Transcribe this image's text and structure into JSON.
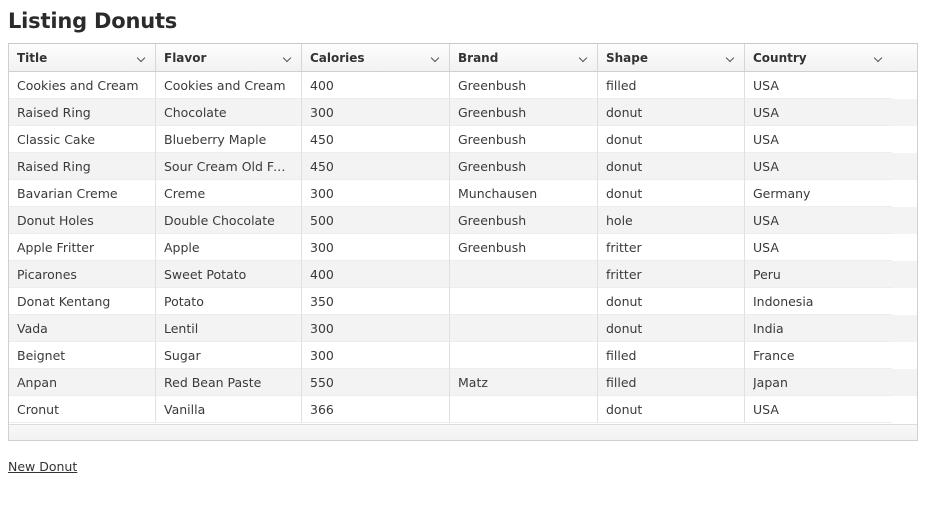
{
  "page": {
    "title": "Listing Donuts"
  },
  "grid": {
    "columns": [
      {
        "label": "Title",
        "icon": "chevron-down-icon"
      },
      {
        "label": "Flavor",
        "icon": "chevron-down-icon"
      },
      {
        "label": "Calories",
        "icon": "chevron-down-icon"
      },
      {
        "label": "Brand",
        "icon": "chevron-down-icon"
      },
      {
        "label": "Shape",
        "icon": "chevron-down-icon"
      },
      {
        "label": "Country",
        "icon": "chevron-down-icon"
      }
    ],
    "rows": [
      {
        "title": "Cookies and Cream",
        "flavor": "Cookies and Cream",
        "calories": "400",
        "brand": "Greenbush",
        "shape": "filled",
        "country": "USA"
      },
      {
        "title": "Raised Ring",
        "flavor": "Chocolate",
        "calories": "300",
        "brand": "Greenbush",
        "shape": "donut",
        "country": "USA"
      },
      {
        "title": "Classic Cake",
        "flavor": "Blueberry Maple",
        "calories": "450",
        "brand": "Greenbush",
        "shape": "donut",
        "country": "USA"
      },
      {
        "title": "Raised Ring",
        "flavor": "Sour Cream Old Fash…",
        "calories": "450",
        "brand": "Greenbush",
        "shape": "donut",
        "country": "USA"
      },
      {
        "title": "Bavarian Creme",
        "flavor": "Creme",
        "calories": "300",
        "brand": "Munchausen",
        "shape": "donut",
        "country": "Germany"
      },
      {
        "title": "Donut Holes",
        "flavor": "Double Chocolate",
        "calories": "500",
        "brand": "Greenbush",
        "shape": "hole",
        "country": "USA"
      },
      {
        "title": "Apple Fritter",
        "flavor": "Apple",
        "calories": "300",
        "brand": "Greenbush",
        "shape": "fritter",
        "country": "USA"
      },
      {
        "title": "Picarones",
        "flavor": "Sweet Potato",
        "calories": "400",
        "brand": "",
        "shape": "fritter",
        "country": "Peru"
      },
      {
        "title": "Donat Kentang",
        "flavor": "Potato",
        "calories": "350",
        "brand": "",
        "shape": "donut",
        "country": "Indonesia"
      },
      {
        "title": "Vada",
        "flavor": "Lentil",
        "calories": "300",
        "brand": "",
        "shape": "donut",
        "country": "India"
      },
      {
        "title": "Beignet",
        "flavor": "Sugar",
        "calories": "300",
        "brand": "",
        "shape": "filled",
        "country": "France"
      },
      {
        "title": "Anpan",
        "flavor": "Red Bean Paste",
        "calories": "550",
        "brand": "Matz",
        "shape": "filled",
        "country": "Japan"
      },
      {
        "title": "Cronut",
        "flavor": "Vanilla",
        "calories": "366",
        "brand": "",
        "shape": "donut",
        "country": "USA"
      }
    ]
  },
  "actions": {
    "new_donut_label": "New Donut"
  }
}
